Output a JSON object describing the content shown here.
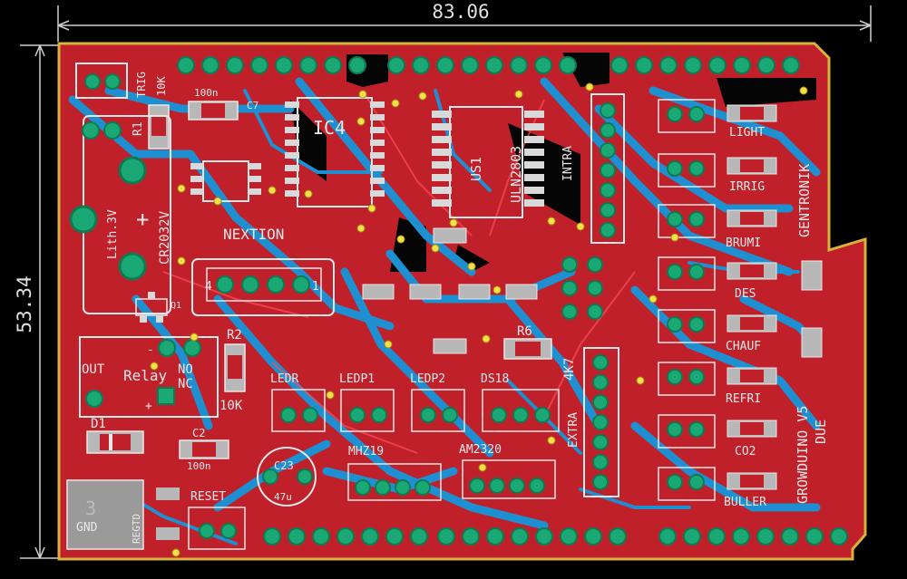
{
  "dimensions": {
    "width_label": "83.06",
    "height_label": "53.34"
  },
  "colors": {
    "background": "#000000",
    "top_copper": "#c0202a",
    "bottom_copper": "#1e8fd0",
    "silkscreen": "#e8e8e8",
    "pad": "#1aa874",
    "outline": "#d8b23a",
    "via": "#f2e04a"
  },
  "components": {
    "ic4": "IC4",
    "us1": "US1",
    "uln": "ULN2803",
    "intra": "INTRA",
    "nextion": "NEXTION",
    "trig": "TRIG",
    "tenk_top": "10K",
    "hundred_n_top": "100n",
    "c7": "C7",
    "r1": "R1",
    "lith": "Lith.3V",
    "cr2032": "CR2032V",
    "q1": "Q1",
    "relay": "Relay",
    "out": "OUT",
    "no": "NO",
    "nc": "NC",
    "r2": "R2",
    "tenk_left": "10K",
    "d1": "D1",
    "c2": "C2",
    "hundred_n_bottom": "100n",
    "reset": "RESET",
    "regtd": "REGTD",
    "gnd": "GND",
    "c23": "C23",
    "fortyseven_u": "47u",
    "ledr": "LEDR",
    "ledp1": "LEDP1",
    "ledp2": "LEDP2",
    "ds18": "DS18",
    "r6": "R6",
    "fourk7": "4K7",
    "extra": "EXTRA",
    "mhz19": "MHZ19",
    "am2320": "AM2320",
    "light": "LIGHT",
    "irrig": "IRRIG",
    "brumi": "BRUMI",
    "des": "DES",
    "chauf": "CHAUF",
    "refri": "REFRI",
    "co2": "CO2",
    "buller": "BULLER",
    "gentronik": "GENTRONIK",
    "growduino": "GROWDUINO V5",
    "due": "DUE",
    "pin4": "4",
    "pin1": "1"
  }
}
